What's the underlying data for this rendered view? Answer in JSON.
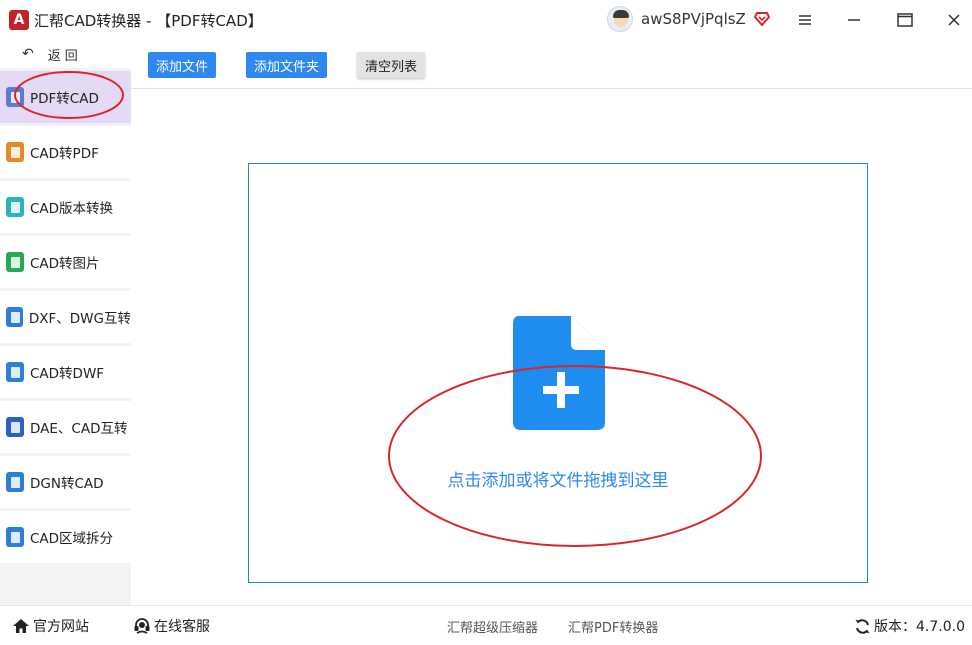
{
  "app": {
    "title": "汇帮CAD转换器 - 【PDF转CAD】",
    "logo_letter": "A",
    "username": "awS8PVjPqlsZ"
  },
  "sidebar": {
    "back_label": "返回",
    "items": [
      {
        "label": "PDF转CAD",
        "icon": "pdf-to-cad-icon",
        "color": "#5b7bd6",
        "active": true
      },
      {
        "label": "CAD转PDF",
        "icon": "cad-to-pdf-icon",
        "color": "#e58a2a"
      },
      {
        "label": "CAD版本转换",
        "icon": "cad-version-icon",
        "color": "#2ab3b8"
      },
      {
        "label": "CAD转图片",
        "icon": "cad-to-image-icon",
        "color": "#27a85a"
      },
      {
        "label": "DXF、DWG互转",
        "icon": "dxf-dwg-icon",
        "color": "#2d7fd6"
      },
      {
        "label": "CAD转DWF",
        "icon": "cad-to-dwf-icon",
        "color": "#2d7fd6"
      },
      {
        "label": "DAE、CAD互转",
        "icon": "dae-cad-icon",
        "color": "#2d5fc8"
      },
      {
        "label": "DGN转CAD",
        "icon": "dgn-to-cad-icon",
        "color": "#2d7fd6"
      },
      {
        "label": "CAD区域拆分",
        "icon": "cad-split-icon",
        "color": "#2d7fd6"
      }
    ]
  },
  "toolbar": {
    "add_file": "添加文件",
    "add_folder": "添加文件夹",
    "clear_list": "清空列表"
  },
  "main": {
    "drop_hint": "点击添加或将文件拖拽到这里"
  },
  "statusbar": {
    "website": "官方网站",
    "support": "在线客服",
    "compressor": "汇帮超级压缩器",
    "pdf_converter": "汇帮PDF转换器",
    "version_label": "版本：4.7.0.0"
  },
  "colors": {
    "accent": "#2e88f0",
    "annotation": "#d9262c",
    "active_nav": "#e4daf6"
  }
}
